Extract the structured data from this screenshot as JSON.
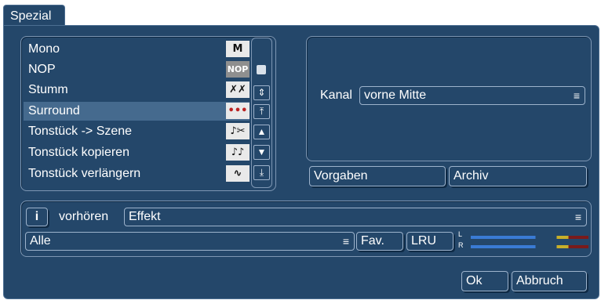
{
  "window": {
    "tab_title": "Spezial"
  },
  "effects_list": {
    "items": [
      {
        "label": "Mono",
        "icon": "mono-icon",
        "glyph": "M"
      },
      {
        "label": "NOP",
        "icon": "nop-icon",
        "glyph": "NOP"
      },
      {
        "label": "Stumm",
        "icon": "mute-icon",
        "glyph": "✗✗"
      },
      {
        "label": "Surround",
        "icon": "surround-icon",
        "glyph": "•••"
      },
      {
        "label": "Tonstück -> Szene",
        "icon": "audio-to-scene-icon",
        "glyph": "♪✂"
      },
      {
        "label": "Tonstück kopieren",
        "icon": "copy-audio-icon",
        "glyph": "♪♪"
      },
      {
        "label": "Tonstück verlängern",
        "icon": "extend-audio-icon",
        "glyph": "∿"
      }
    ],
    "selected_index": 3
  },
  "settings": {
    "kanal_label": "Kanal",
    "kanal_value": "vorne Mitte"
  },
  "presets": {
    "vorgaben_label": "Vorgaben",
    "archiv_label": "Archiv"
  },
  "preview": {
    "info_label": "i",
    "vorhoeren_label": "vorhören",
    "effect_value": "Effekt"
  },
  "filter": {
    "category_value": "Alle",
    "fav_label": "Fav.",
    "lru_label": "LRU"
  },
  "meter": {
    "left_label": "L",
    "right_label": "R"
  },
  "footer": {
    "ok_label": "Ok",
    "cancel_label": "Abbruch"
  },
  "colors": {
    "background": "#24476a",
    "border": "#9db3cc",
    "selection": "#456a8e"
  }
}
